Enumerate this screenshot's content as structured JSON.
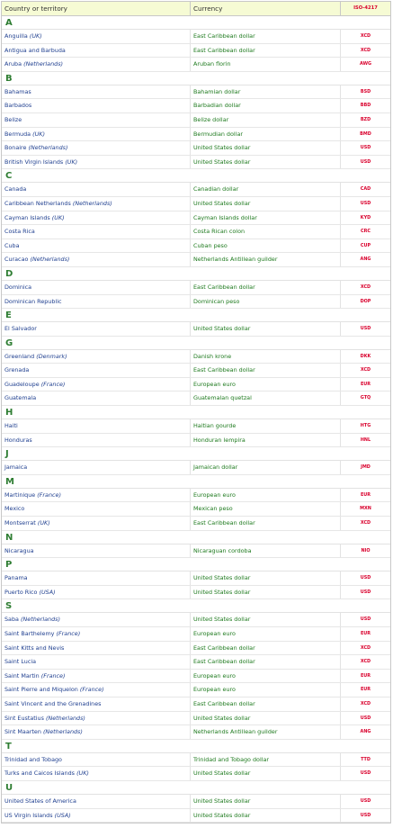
{
  "headers": {
    "country": "Country or territory",
    "currency": "Currency",
    "code": "ISO-4217"
  },
  "groups": [
    {
      "letter": "A",
      "rows": [
        {
          "name": "Anguilla",
          "note": "(UK)",
          "currency": "East Caribbean dollar",
          "code": "XCD"
        },
        {
          "name": "Antigua and Barbuda",
          "note": "",
          "currency": "East Caribbean dollar",
          "code": "XCD"
        },
        {
          "name": "Aruba",
          "note": "(Netherlands)",
          "currency": "Aruban florin",
          "code": "AWG"
        }
      ]
    },
    {
      "letter": "B",
      "rows": [
        {
          "name": "Bahamas",
          "note": "",
          "currency": "Bahamian dollar",
          "code": "BSD"
        },
        {
          "name": "Barbados",
          "note": "",
          "currency": "Barbadian dollar",
          "code": "BBD"
        },
        {
          "name": "Belize",
          "note": "",
          "currency": "Belize dollar",
          "code": "BZD"
        },
        {
          "name": "Bermuda",
          "note": "(UK)",
          "currency": "Bermudian dollar",
          "code": "BMD"
        },
        {
          "name": "Bonaire",
          "note": "(Netherlands)",
          "currency": "United States dollar",
          "code": "USD"
        },
        {
          "name": "British Virgin Islands",
          "note": "(UK)",
          "currency": "United States dollar",
          "code": "USD"
        }
      ]
    },
    {
      "letter": "C",
      "rows": [
        {
          "name": "Canada",
          "note": "",
          "currency": "Canadian dollar",
          "code": "CAD"
        },
        {
          "name": "Caribbean Netherlands",
          "note": "(Netherlands)",
          "currency": "United States dollar",
          "code": "USD"
        },
        {
          "name": "Cayman Islands",
          "note": "(UK)",
          "currency": "Cayman Islands dollar",
          "code": "KYD"
        },
        {
          "name": "Costa Rica",
          "note": "",
          "currency": "Costa Rican colon",
          "code": "CRC"
        },
        {
          "name": "Cuba",
          "note": "",
          "currency": "Cuban peso",
          "code": "CUP"
        },
        {
          "name": "Curacao",
          "note": "(Netherlands)",
          "currency": "Netherlands Antillean guilder",
          "code": "ANG"
        }
      ]
    },
    {
      "letter": "D",
      "rows": [
        {
          "name": "Dominica",
          "note": "",
          "currency": "East Caribbean dollar",
          "code": "XCD"
        },
        {
          "name": "Dominican Republic",
          "note": "",
          "currency": "Dominican peso",
          "code": "DOP"
        }
      ]
    },
    {
      "letter": "E",
      "rows": [
        {
          "name": "El Salvador",
          "note": "",
          "currency": "United States dollar",
          "code": "USD"
        }
      ]
    },
    {
      "letter": "G",
      "rows": [
        {
          "name": "Greenland",
          "note": "(Denmark)",
          "currency": "Danish krone",
          "code": "DKK"
        },
        {
          "name": "Grenada",
          "note": "",
          "currency": "East Caribbean dollar",
          "code": "XCD"
        },
        {
          "name": "Guadeloupe",
          "note": "(France)",
          "currency": "European euro",
          "code": "EUR"
        },
        {
          "name": "Guatemala",
          "note": "",
          "currency": "Guatemalan quetzal",
          "code": "GTQ"
        }
      ]
    },
    {
      "letter": "H",
      "rows": [
        {
          "name": "Haiti",
          "note": "",
          "currency": "Haitian gourde",
          "code": "HTG"
        },
        {
          "name": "Honduras",
          "note": "",
          "currency": "Honduran lempira",
          "code": "HNL"
        }
      ]
    },
    {
      "letter": "J",
      "rows": [
        {
          "name": "Jamaica",
          "note": "",
          "currency": "Jamaican dollar",
          "code": "JMD"
        }
      ]
    },
    {
      "letter": "M",
      "rows": [
        {
          "name": "Martinique",
          "note": "(France)",
          "currency": "European euro",
          "code": "EUR"
        },
        {
          "name": "Mexico",
          "note": "",
          "currency": "Mexican peso",
          "code": "MXN"
        },
        {
          "name": "Montserrat",
          "note": "(UK)",
          "currency": "East Caribbean dollar",
          "code": "XCD"
        }
      ]
    },
    {
      "letter": "N",
      "rows": [
        {
          "name": "Nicaragua",
          "note": "",
          "currency": "Nicaraguan cordoba",
          "code": "NIO"
        }
      ]
    },
    {
      "letter": "P",
      "rows": [
        {
          "name": "Panama",
          "note": "",
          "currency": "United States dollar",
          "code": "USD"
        },
        {
          "name": "Puerto Rico",
          "note": "(USA)",
          "currency": "United States dollar",
          "code": "USD"
        }
      ]
    },
    {
      "letter": "S",
      "rows": [
        {
          "name": "Saba",
          "note": "(Netherlands)",
          "currency": "United States dollar",
          "code": "USD"
        },
        {
          "name": "Saint Barthelemy",
          "note": "(France)",
          "currency": "European euro",
          "code": "EUR"
        },
        {
          "name": "Saint Kitts and Nevis",
          "note": "",
          "currency": "East Caribbean dollar",
          "code": "XCD"
        },
        {
          "name": "Saint Lucia",
          "note": "",
          "currency": "East Caribbean dollar",
          "code": "XCD"
        },
        {
          "name": "Saint Martin",
          "note": "(France)",
          "currency": "European euro",
          "code": "EUR"
        },
        {
          "name": "Saint Pierre and Miquelon",
          "note": "(France)",
          "currency": "European euro",
          "code": "EUR"
        },
        {
          "name": "Saint Vincent and the Grenadines",
          "note": "",
          "currency": "East Caribbean dollar",
          "code": "XCD"
        },
        {
          "name": "Sint Eustatius",
          "note": "(Netherlands)",
          "currency": "United States dollar",
          "code": "USD"
        },
        {
          "name": "Sint Maarten",
          "note": "(Netherlands)",
          "currency": "Netherlands Antillean guilder",
          "code": "ANG"
        }
      ]
    },
    {
      "letter": "T",
      "rows": [
        {
          "name": "Trinidad and Tobago",
          "note": "",
          "currency": "Trinidad and Tobago dollar",
          "code": "TTD"
        },
        {
          "name": "Turks and Caicos Islands",
          "note": "(UK)",
          "currency": "United States dollar",
          "code": "USD"
        }
      ]
    },
    {
      "letter": "U",
      "rows": [
        {
          "name": "United States of America",
          "note": "",
          "currency": "United States dollar",
          "code": "USD"
        },
        {
          "name": "US Virgin Islands",
          "note": "(USA)",
          "currency": "United States dollar",
          "code": "USD"
        }
      ]
    }
  ]
}
